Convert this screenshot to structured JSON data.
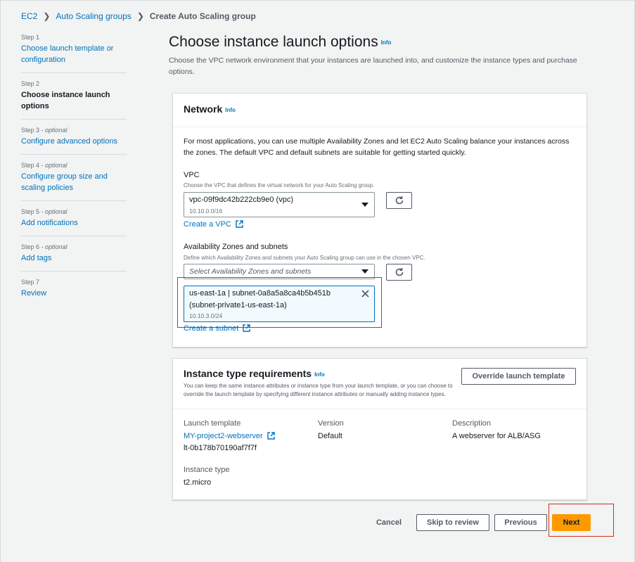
{
  "breadcrumb": {
    "items": [
      "EC2",
      "Auto Scaling groups"
    ],
    "current": "Create Auto Scaling group"
  },
  "steps": [
    {
      "label": "Step 1",
      "optional": "",
      "title": "Choose launch template or configuration"
    },
    {
      "label": "Step 2",
      "optional": "",
      "title": "Choose instance launch options"
    },
    {
      "label": "Step 3 - ",
      "optional": "optional",
      "title": "Configure advanced options"
    },
    {
      "label": "Step 4 - ",
      "optional": "optional",
      "title": "Configure group size and scaling policies"
    },
    {
      "label": "Step 5 - ",
      "optional": "optional",
      "title": "Add notifications"
    },
    {
      "label": "Step 6 - ",
      "optional": "optional",
      "title": "Add tags"
    },
    {
      "label": "Step 7",
      "optional": "",
      "title": "Review"
    }
  ],
  "page": {
    "title": "Choose instance launch options",
    "info": "Info",
    "description": "Choose the VPC network environment that your instances are launched into, and customize the instance types and purchase options."
  },
  "network": {
    "title": "Network",
    "info": "Info",
    "intro": "For most applications, you can use multiple Availability Zones and let EC2 Auto Scaling balance your instances across the zones. The default VPC and default subnets are suitable for getting started quickly.",
    "vpc_label": "VPC",
    "vpc_desc": "Choose the VPC that defines the virtual network for your Auto Scaling group.",
    "vpc_value": "vpc-09f9dc42b222cb9e0 (vpc)",
    "vpc_cidr": "10.10.0.0/16",
    "create_vpc": "Create a VPC",
    "az_label": "Availability Zones and subnets",
    "az_desc": "Define which Availability Zones and subnets your Auto Scaling group can use in the chosen VPC.",
    "az_placeholder": "Select Availability Zones and subnets",
    "token_line1": "us-east-1a | subnet-0a8a5a8ca4b5b451b",
    "token_line2": "(subnet-private1-us-east-1a)",
    "token_cidr": "10.10.3.0/24",
    "create_subnet": "Create a subnet"
  },
  "instance": {
    "title": "Instance type requirements",
    "info": "Info",
    "desc": "You can keep the same instance attributes or instance type from your launch template, or you can choose to override the launch template by specifying different instance attributes or manually adding instance types.",
    "override_label": "Override launch template",
    "lt_label": "Launch template",
    "lt_name": "MY-project2-webserver",
    "lt_id": "lt-0b178b70190af7f7f",
    "version_label": "Version",
    "version_value": "Default",
    "description_label": "Description",
    "description_value": "A webserver for ALB/ASG",
    "type_label": "Instance type",
    "type_value": "t2.micro"
  },
  "footer": {
    "cancel": "Cancel",
    "skip": "Skip to review",
    "previous": "Previous",
    "next": "Next"
  },
  "colors": {
    "link": "#0073bb",
    "primary": "#ff9900",
    "highlight": "#d13212"
  }
}
